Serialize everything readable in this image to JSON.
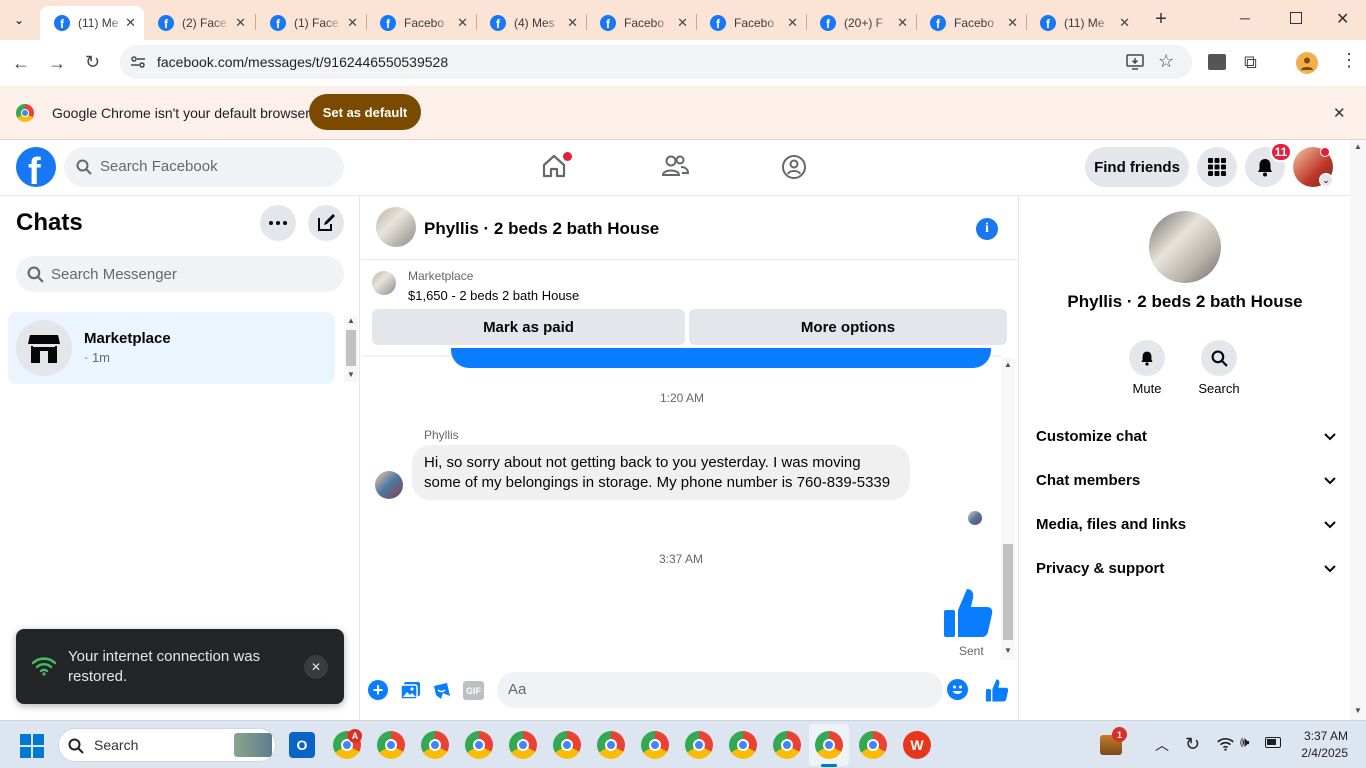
{
  "tabs": [
    {
      "title": "(11) Me",
      "active": true
    },
    {
      "title": "(2) Face"
    },
    {
      "title": "(1) Face"
    },
    {
      "title": "Facebo"
    },
    {
      "title": "(4) Mes"
    },
    {
      "title": "Facebo"
    },
    {
      "title": "Facebo"
    },
    {
      "title": "(20+) F"
    },
    {
      "title": "Facebo"
    },
    {
      "title": "(11) Me"
    }
  ],
  "browser": {
    "url": "facebook.com/messages/t/9162446550539528",
    "infobar_text": "Google Chrome isn't your default browser",
    "set_default_label": "Set as default"
  },
  "facebook": {
    "search_placeholder": "Search Facebook",
    "find_friends_label": "Find friends",
    "notification_count": "11"
  },
  "chats": {
    "title": "Chats",
    "search_placeholder": "Search Messenger",
    "items": [
      {
        "name": "Marketplace",
        "time": "· 1m"
      }
    ]
  },
  "conversation": {
    "title": "Phyllis · 2 beds 2 bath House",
    "listing_source": "Marketplace",
    "listing_price": "$1,650 - 2 beds 2 bath House",
    "mark_paid_label": "Mark as paid",
    "more_options_label": "More options",
    "time_1": "1:20 AM",
    "sender": "Phyllis",
    "message": "Hi, so sorry about not getting back to you yesterday. I was moving some of my belongings in storage. My phone number is 760-839-5339",
    "time_2": "3:37 AM",
    "sent_status": "Sent",
    "composer_placeholder": "Aa"
  },
  "details": {
    "name": "Phyllis · 2 beds 2 bath House",
    "mute_label": "Mute",
    "search_label": "Search",
    "sections": [
      "Customize chat",
      "Chat members",
      "Media, files and links",
      "Privacy & support"
    ]
  },
  "toast": {
    "text": "Your internet connection was restored."
  },
  "taskbar": {
    "search_label": "Search",
    "time": "3:37 AM",
    "date": "2/4/2025",
    "chrome_badge": "A",
    "tray_badge": "1"
  },
  "colors": {
    "brand": "#1877f2",
    "tabstrip": "#fbe3d6",
    "set_default": "#7a4a00"
  }
}
